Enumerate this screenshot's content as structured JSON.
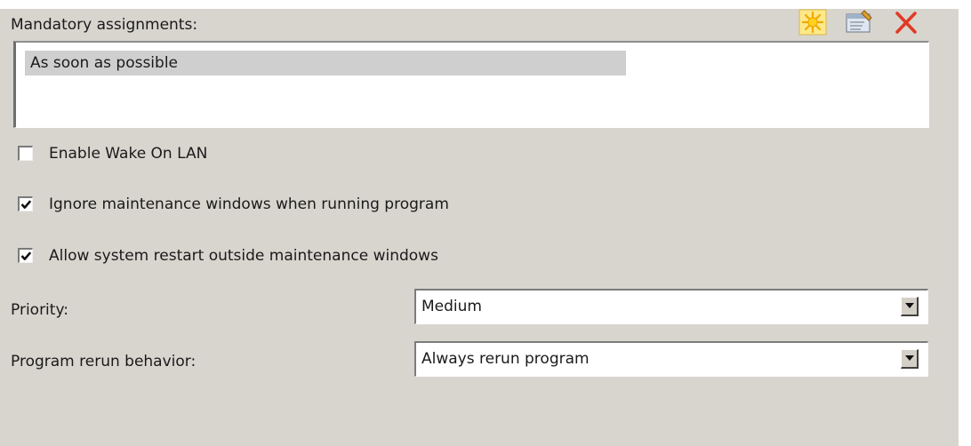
{
  "mandatory_assignments": {
    "label": "Mandatory assignments:",
    "items": [
      "As soon as possible"
    ],
    "toolbar": {
      "new_icon": "new-icon",
      "properties_icon": "properties-icon",
      "delete_icon": "delete-icon"
    }
  },
  "options": {
    "wake_on_lan": {
      "label": "Enable Wake On LAN",
      "checked": false
    },
    "ignore_maintenance": {
      "label": "Ignore maintenance windows when running program",
      "checked": true
    },
    "allow_restart": {
      "label": "Allow system restart outside maintenance windows",
      "checked": true
    }
  },
  "priority": {
    "label": "Priority:",
    "value": "Medium"
  },
  "rerun": {
    "label": "Program rerun behavior:",
    "value": "Always rerun program"
  },
  "colors": {
    "panel_background": "#d8d5cf",
    "selected_row": "#cfcfcf",
    "delete_red": "#e03a25",
    "new_yellow": "#f5c400"
  }
}
